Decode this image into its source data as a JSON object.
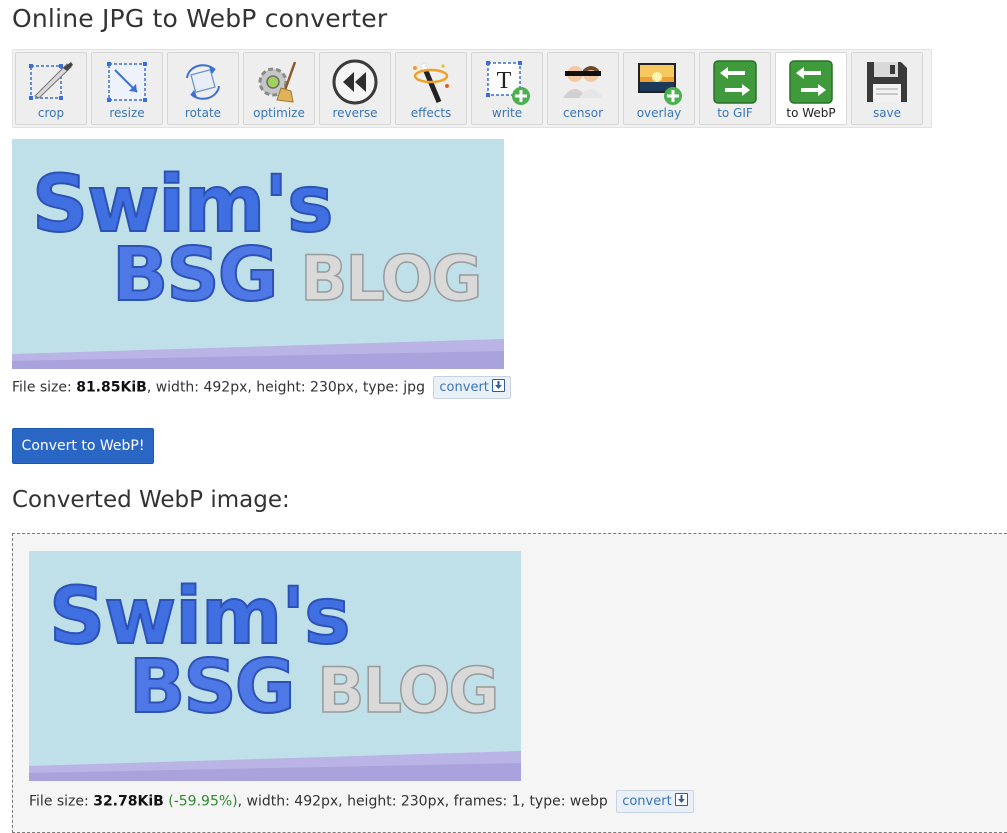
{
  "page": {
    "title": "Online JPG to WebP converter"
  },
  "toolbar": {
    "active_tool": "to WebP",
    "tools": [
      {
        "label": "crop",
        "icon": "crop-icon"
      },
      {
        "label": "resize",
        "icon": "resize-icon"
      },
      {
        "label": "rotate",
        "icon": "rotate-icon"
      },
      {
        "label": "optimize",
        "icon": "optimize-icon"
      },
      {
        "label": "reverse",
        "icon": "reverse-icon"
      },
      {
        "label": "effects",
        "icon": "effects-icon"
      },
      {
        "label": "write",
        "icon": "write-icon"
      },
      {
        "label": "censor",
        "icon": "censor-icon"
      },
      {
        "label": "overlay",
        "icon": "overlay-icon"
      },
      {
        "label": "to GIF",
        "icon": "convert-arrows-icon"
      },
      {
        "label": "to WebP",
        "icon": "convert-arrows-icon"
      },
      {
        "label": "save",
        "icon": "save-icon"
      }
    ]
  },
  "source_image": {
    "text_line1": "Swim's",
    "text_line2_a": "BSG",
    "text_line2_b": "BLOG",
    "colors": {
      "background": "#bfe0e8",
      "blue": "#3f6fe0",
      "yellow": "#f4d36a",
      "gray": "#d9d9d9",
      "band": "#b9b3e6"
    }
  },
  "source_info": {
    "prefix": "File size: ",
    "size": "81.85KiB",
    "rest": ", width: 492px, height: 230px, type: jpg",
    "convert_label": "convert"
  },
  "convert_button": {
    "label": "Convert to WebP!"
  },
  "result": {
    "heading": "Converted WebP image:",
    "prefix": "File size: ",
    "size": "32.78KiB",
    "change": "(-59.95%)",
    "rest": ", width: 492px, height: 230px, frames: 1, type: webp",
    "convert_label": "convert"
  },
  "colors": {
    "link": "#3a76b5",
    "button": "#2a66c4",
    "positive": "#2f8a2f"
  }
}
